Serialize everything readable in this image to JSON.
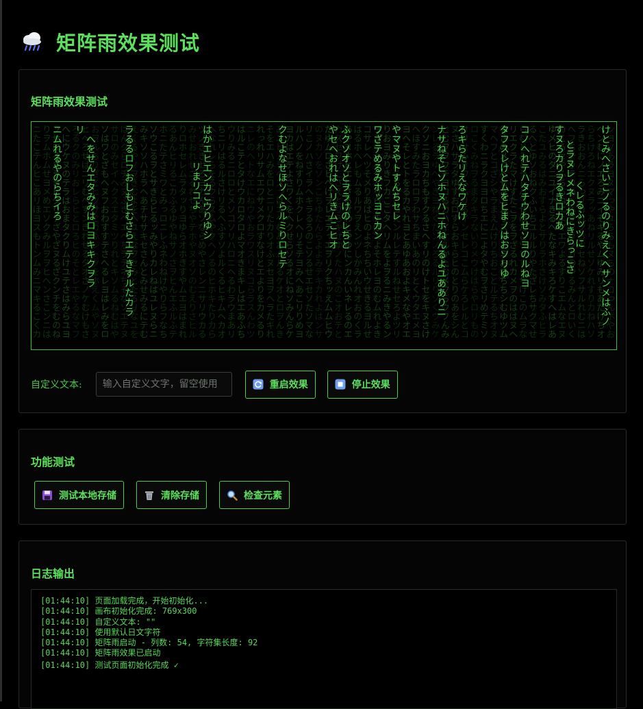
{
  "header": {
    "title": "矩阵雨效果测试",
    "icon": "cloud-rain-icon"
  },
  "matrix_panel": {
    "title": "矩阵雨效果测试",
    "columns": [
      "ニムれるやのらちイろ",
      "リ",
      "ラるるロフおしもヒむさらエテきすルたカラ",
      "へをせんエタみみはロヨキキクヲラ",
      "リまリコよ",
      "はかエヒエンカこウりゆシ",
      "クむよなせほソヘらルミりロセテ",
      "ふクソオソとヲラけのレちと",
      "やセヘおれはへリきムこヒオ",
      "ワざテめるみホッヨこカン",
      "やマヌやトすんちセレ",
      "ナサねそヒソホヌハニホねんるよユあありニ",
      "ろキらたリえなワケけ",
      "タフスレけとムをヒまノはおソリゆ",
      "コノへれテハタチウわせソヨのルねヨ",
      "すヌろカりヲるきロカあ",
      "とラヌレメネわねにきらっこさ",
      "くレるふッツに",
      "けとみへさいこノるのりみえくへサンメはふノ"
    ],
    "custom_text_label": "自定义文本:",
    "custom_text_value": "",
    "custom_text_placeholder": "输入自定义文字，留空使用",
    "restart_label": "重启效果",
    "stop_label": "停止效果",
    "restart_icon": "refresh-icon",
    "stop_icon": "stop-icon"
  },
  "func_panel": {
    "title": "功能测试",
    "buttons": [
      {
        "label": "测试本地存储",
        "icon": "floppy-disk-icon"
      },
      {
        "label": "清除存储",
        "icon": "trash-icon"
      },
      {
        "label": "检查元素",
        "icon": "magnifier-icon"
      }
    ]
  },
  "log_panel": {
    "title": "日志输出",
    "lines": [
      "[01:44:10] 页面加载完成，开始初始化...",
      "[01:44:10] 画布初始化完成: 769x300",
      "[01:44:10] 自定义文本: \"\"",
      "[01:44:10] 使用默认日文字符",
      "[01:44:10] 矩阵雨启动 - 列数: 54, 字符集长度: 92",
      "[01:44:10] 矩阵雨效果已启动",
      "[01:44:10] 测试页面初始化完成 ✓"
    ]
  },
  "colors": {
    "accent": "#5ce05c",
    "background": "#000000",
    "border": "#4ccf4c"
  }
}
